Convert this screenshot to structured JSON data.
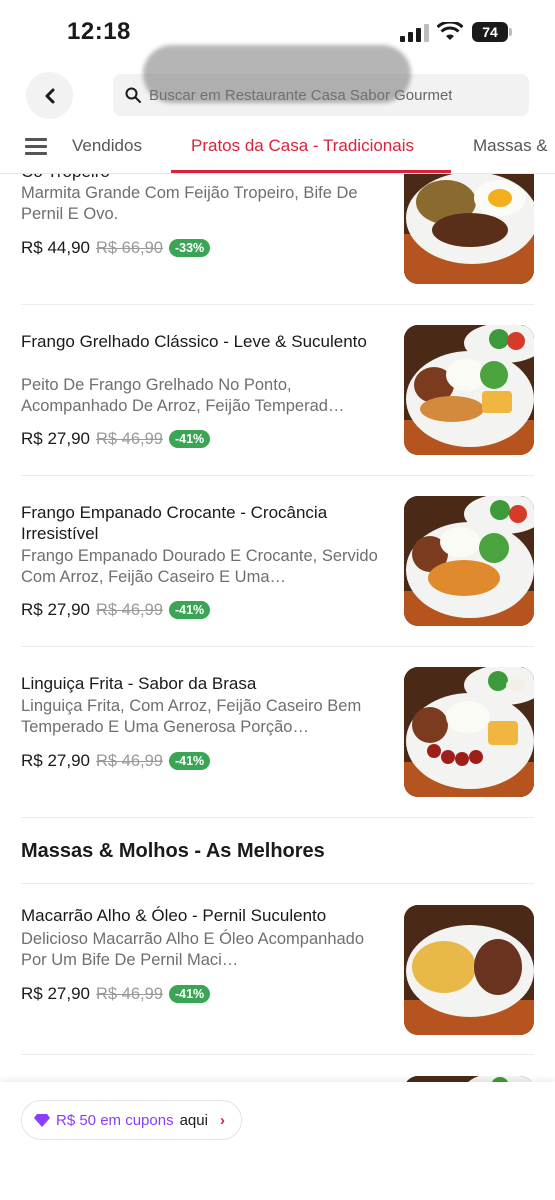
{
  "status": {
    "time": "12:18",
    "battery": "74"
  },
  "header": {
    "search_text": "Buscar em Restaurante Casa Sabor Gourmet"
  },
  "tabs": [
    {
      "label": "Vendidos"
    },
    {
      "label": "Pratos da Casa - Tradicionais"
    },
    {
      "label": "Massas &"
    }
  ],
  "items": [
    {
      "title": "Co Tropeiro",
      "description": "Marmita Grande Com Feijão Tropeiro, Bife De Pernil E Ovo.",
      "price": "R$ 44,90",
      "old_price": "R$ 66,90",
      "discount": "-33%"
    },
    {
      "title": "Frango Grelhado Clássico - Leve & Suculento",
      "description": "Peito De Frango Grelhado No Ponto, Acompanhado De Arroz, Feijão Temperad…",
      "price": "R$ 27,90",
      "old_price": "R$ 46,99",
      "discount": "-41%"
    },
    {
      "title": "Frango Empanado Crocante - Crocância Irresistível",
      "description": "Frango Empanado Dourado E Crocante, Servido Com Arroz, Feijão Caseiro E Uma…",
      "price": "R$ 27,90",
      "old_price": "R$ 46,99",
      "discount": "-41%"
    },
    {
      "title": "Linguiça Frita - Sabor da Brasa",
      "description": "Linguiça Frita, Com Arroz, Feijão Caseiro Bem Temperado E Uma Generosa Porção…",
      "price": "R$ 27,90",
      "old_price": "R$ 46,99",
      "discount": "-41%"
    }
  ],
  "section_massas": {
    "title": "Massas & Molhos - As Melhores",
    "items": [
      {
        "title": "Macarrão Alho & Óleo - Pernil Suculento",
        "description": "Delicioso Macarrão Alho E Óleo Acompanhado Por Um Bife De Pernil Maci…",
        "price": "R$ 27,90",
        "old_price": "R$ 46,99",
        "discount": "-41%"
      }
    ]
  },
  "coupon": {
    "amount": "R$ 50 em cupons",
    "suffix": "aqui",
    "arrow": "›"
  },
  "icons": [
    "back-arrow-icon",
    "search-icon",
    "menu-icon",
    "signal-icon",
    "wifi-icon",
    "battery-icon",
    "diamond-icon",
    "chevron-right-icon"
  ],
  "colors": {
    "accent": "#d9233a",
    "discount_bg": "#3aa655",
    "coupon_accent": "#8a3ffc"
  }
}
